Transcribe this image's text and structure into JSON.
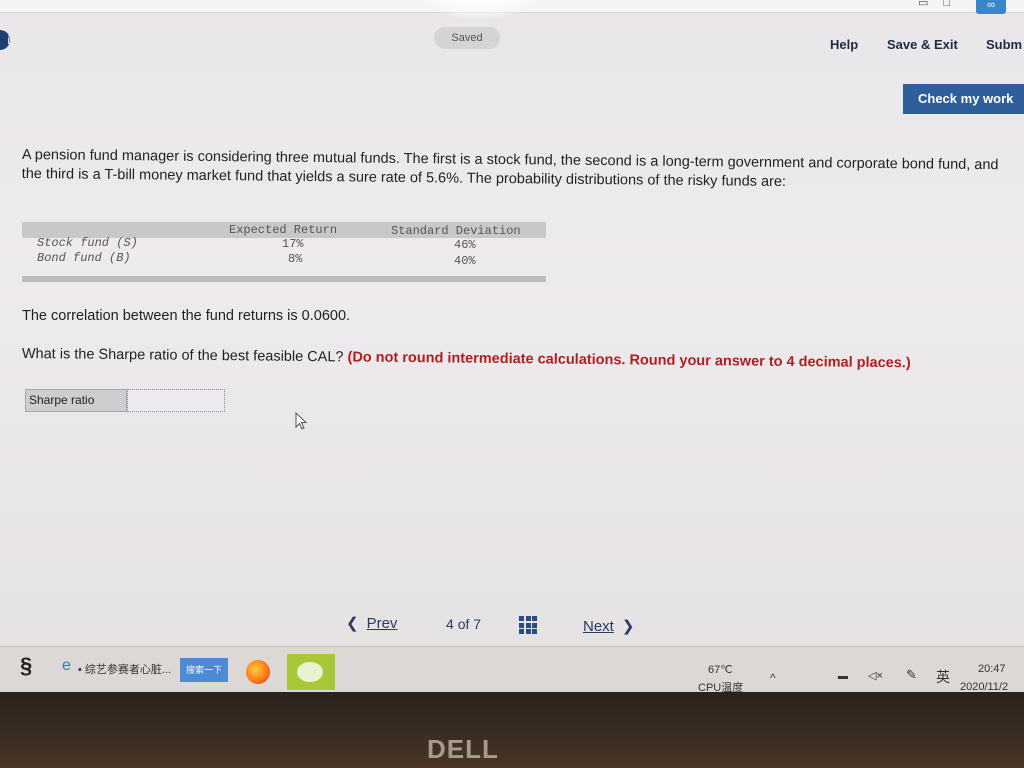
{
  "header": {
    "saved_label": "Saved",
    "help_label": "Help",
    "save_exit_label": "Save & Exit",
    "submit_label": "Subm",
    "check_label": "Check my work"
  },
  "question": {
    "text": "A pension fund manager is considering three mutual funds. The first is a stock fund, the second is a long-term government and corporate bond fund, and the third is a T-bill money market fund that yields a sure rate of 5.6%. The probability distributions of the risky funds are:",
    "table": {
      "headers": [
        "Expected Return",
        "Standard Deviation"
      ],
      "rows": [
        {
          "label": "Stock fund (S)",
          "expected_return": "17%",
          "std_dev": "46%"
        },
        {
          "label": "Bond fund (B)",
          "expected_return": "8%",
          "std_dev": "40%"
        }
      ]
    },
    "correlation_text": "The correlation between the fund returns is 0.0600.",
    "ask_text": "What is the Sharpe ratio of the best feasible CAL?",
    "ask_hint": "(Do not round intermediate calculations. Round your answer to 4 decimal places.)",
    "answer_label": "Sharpe ratio",
    "answer_value": ""
  },
  "navigation": {
    "prev_label": "Prev",
    "page_current": "4",
    "page_of": "of",
    "page_total": "7",
    "next_label": "Next"
  },
  "taskbar": {
    "ie_text": "• 综艺参赛者心脏...",
    "search_label": "搜索一下",
    "cpu_temp": "67℃",
    "cpu_label": "CPU温度",
    "ime": "英",
    "time": "20:47",
    "date": "2020/11/2"
  },
  "bezel": {
    "brand": "DELL"
  },
  "colors": {
    "accent_blue": "#2e5f9a",
    "hint_red": "#b01e1e"
  }
}
